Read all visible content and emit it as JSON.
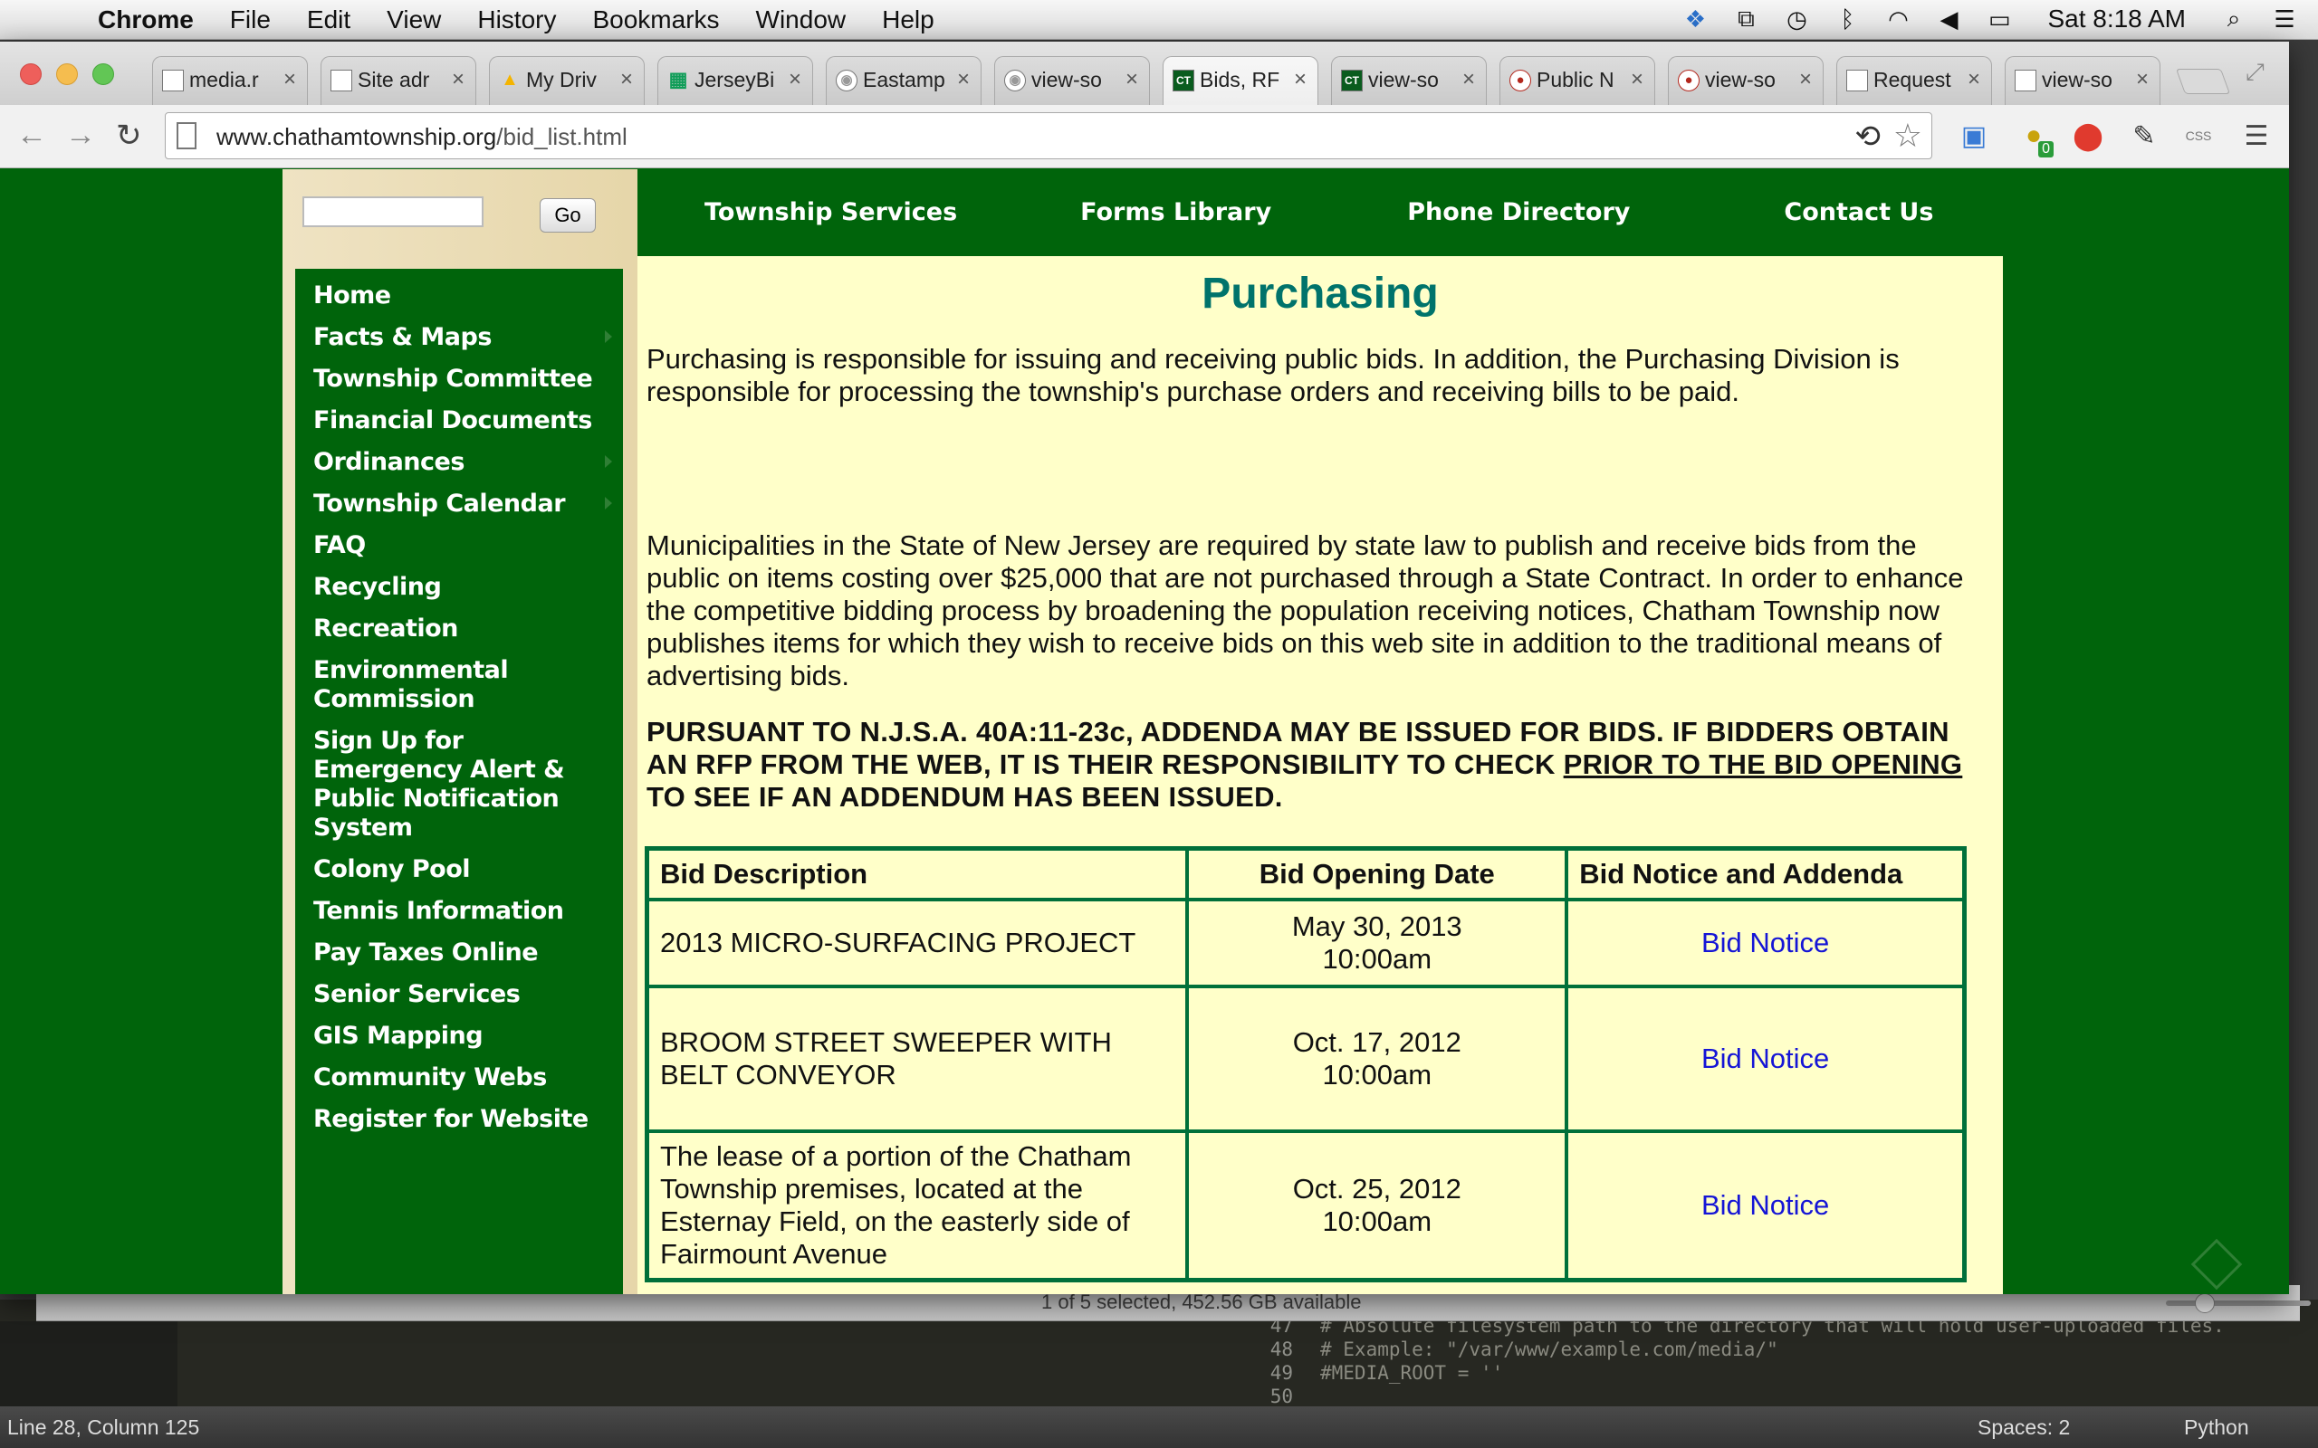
{
  "menubar": {
    "app_name": "Chrome",
    "menus": [
      "File",
      "Edit",
      "View",
      "History",
      "Bookmarks",
      "Window",
      "Help"
    ],
    "clock": "Sat 8:18 AM",
    "status_icons": [
      "dropbox-icon",
      "copy-icon",
      "time-machine-icon",
      "bluetooth-icon",
      "wifi-icon",
      "volume-icon",
      "battery-icon",
      "search-icon",
      "list-icon"
    ]
  },
  "browser": {
    "tabs": [
      {
        "title": "media.r",
        "icon": "page-icon"
      },
      {
        "title": "Site adr",
        "icon": "page-icon"
      },
      {
        "title": "My Driv",
        "icon": "drive-icon"
      },
      {
        "title": "JerseyBi",
        "icon": "sheet-icon"
      },
      {
        "title": "Eastamp",
        "icon": "globe-icon"
      },
      {
        "title": "view-so",
        "icon": "globe-icon"
      },
      {
        "title": "Bids, RF",
        "icon": "ct-icon",
        "active": true
      },
      {
        "title": "view-so",
        "icon": "ct-icon"
      },
      {
        "title": "Public N",
        "icon": "red-icon"
      },
      {
        "title": "view-so",
        "icon": "red-icon"
      },
      {
        "title": "Request",
        "icon": "page-icon"
      },
      {
        "title": "view-so",
        "icon": "page-icon"
      }
    ],
    "url_host": "www.chathamtownship.org",
    "url_path": "/bid_list.html",
    "badge_count": "0"
  },
  "site": {
    "search": {
      "value": "",
      "go_label": "Go"
    },
    "top_nav": [
      "Township Services",
      "Forms Library",
      "Phone Directory",
      "Contact Us"
    ],
    "left_nav": [
      {
        "label": "Home",
        "submenu": false
      },
      {
        "label": "Facts & Maps",
        "submenu": true
      },
      {
        "label": "Township Committee",
        "submenu": false
      },
      {
        "label": "Financial Documents",
        "submenu": false
      },
      {
        "label": "Ordinances",
        "submenu": true
      },
      {
        "label": "Township Calendar",
        "submenu": true
      },
      {
        "label": "FAQ",
        "submenu": false
      },
      {
        "label": "Recycling",
        "submenu": false
      },
      {
        "label": "Recreation",
        "submenu": false
      },
      {
        "label": "Environmental Commission",
        "submenu": false
      },
      {
        "label": "Sign Up for Emergency Alert & Public Notification System",
        "submenu": false
      },
      {
        "label": "Colony Pool",
        "submenu": false
      },
      {
        "label": "Tennis Information",
        "submenu": false
      },
      {
        "label": "Pay Taxes Online",
        "submenu": false
      },
      {
        "label": "Senior Services",
        "submenu": false
      },
      {
        "label": "GIS Mapping",
        "submenu": false
      },
      {
        "label": "Community Webs",
        "submenu": false
      },
      {
        "label": "Register for Website",
        "submenu": false
      }
    ],
    "page_title": "Purchasing",
    "paragraph1": "Purchasing is responsible for issuing and receiving public bids. In addition, the Purchasing Division is responsible for processing the township's purchase orders and receiving bills to be paid.",
    "paragraph2": "Municipalities in the State of New Jersey are required by state law to publish and receive bids from the public on items costing over $25,000 that are not purchased through a State Contract. In order to enhance the competitive bidding process by broadening the population receiving notices, Chatham Township now publishes items for which they wish to receive bids on this web site in addition to the traditional means of advertising bids.",
    "notice_part1": "PURSUANT TO N.J.S.A. 40A:11-23c, ADDENDA MAY BE ISSUED FOR BIDS. IF BIDDERS OBTAIN AN RFP FROM THE WEB, IT IS THEIR RESPONSIBILITY TO CHECK ",
    "notice_underlined": "PRIOR TO THE BID OPENING",
    "notice_part2": " TO SEE IF AN ADDENDUM HAS BEEN ISSUED.",
    "table": {
      "headers": [
        "Bid Description",
        "Bid Opening Date",
        "Bid Notice and Addenda"
      ],
      "rows": [
        {
          "description": "2013 MICRO-SURFACING PROJECT",
          "date": "May 30, 2013",
          "time": "10:00am",
          "link": "Bid Notice"
        },
        {
          "description": "BROOM STREET SWEEPER WITH BELT CONVEYOR",
          "date": "Oct. 17, 2012",
          "time": "10:00am",
          "link": "Bid Notice"
        },
        {
          "description": "The lease of a portion of the Chatham Township premises, located at the Esternay Field, on the easterly side of Fairmount Avenue",
          "date": "Oct. 25, 2012",
          "time": "10:00am",
          "link": "Bid Notice"
        }
      ]
    }
  },
  "finder": {
    "info": "1 of 5 selected, 452.56 GB available"
  },
  "editor": {
    "lines": [
      {
        "num": "47",
        "text": "# Absolute filesystem path to the directory that will hold user-uploaded files."
      },
      {
        "num": "48",
        "text": "# Example: \"/var/www/example.com/media/\""
      },
      {
        "num": "49",
        "text": "#MEDIA_ROOT = ''"
      },
      {
        "num": "50",
        "text": ""
      }
    ],
    "status_left": "Line 28, Column 125",
    "status_spaces": "Spaces: 2",
    "status_lang": "Python"
  }
}
